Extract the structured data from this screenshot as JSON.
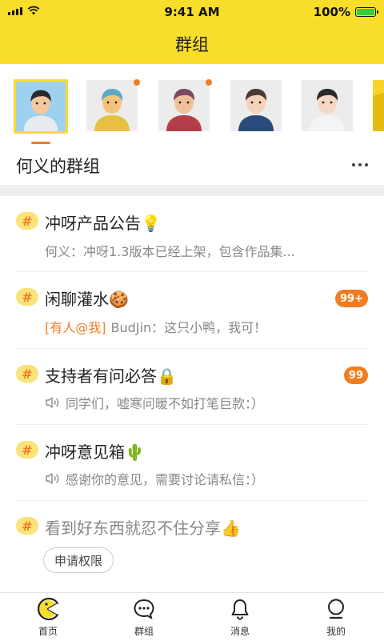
{
  "status_bar": {
    "time": "9:41 AM",
    "battery": "100%"
  },
  "nav": {
    "title": "群组"
  },
  "avatars": [
    {
      "name": "avatar-cartoon-man",
      "selected": true,
      "has_dot": false,
      "colors": {
        "bg": "#9ed0f0",
        "skin": "#f4c7a0",
        "hair": "#2a2a2a",
        "shirt": "#e7ecf0"
      }
    },
    {
      "name": "avatar-girl-pearl-earring",
      "selected": false,
      "has_dot": true,
      "colors": {
        "bg": "#ececec",
        "skin": "#f3c37a",
        "hair": "#5aa8c8",
        "shirt": "#e8bf40"
      }
    },
    {
      "name": "avatar-woman-purple-hair",
      "selected": false,
      "has_dot": true,
      "colors": {
        "bg": "#ececec",
        "skin": "#f0c09a",
        "hair": "#7a4a66",
        "shirt": "#b53d4a"
      }
    },
    {
      "name": "avatar-man-red-tie",
      "selected": false,
      "has_dot": false,
      "colors": {
        "bg": "#ececec",
        "skin": "#f4d2b8",
        "hair": "#4a3a36",
        "shirt": "#2a4a7c"
      }
    },
    {
      "name": "avatar-woman-sunglasses",
      "selected": false,
      "has_dot": false,
      "colors": {
        "bg": "#ececec",
        "skin": "#f4d7c4",
        "hair": "#2a2a2a",
        "shirt": "#f4f4f4"
      }
    },
    {
      "name": "avatar-partial-yellow",
      "selected": false,
      "has_dot": false,
      "colors": {
        "bg": "#f8d32a",
        "skin": "#f8d32a",
        "hair": "#e6bb10",
        "shirt": "#f8d32a"
      }
    }
  ],
  "group_header": {
    "title": "何义的群组"
  },
  "groups": [
    {
      "title": "冲呀产品公告💡",
      "subtitle": "何义：冲呀1.3版本已经上架，包含作品集...",
      "mention": "",
      "speaker_icon": false,
      "badge": "",
      "muted": false
    },
    {
      "title": "闲聊灌水🍪",
      "subtitle": "BudJin：这只小鸭，我可！",
      "mention": "[有人@我]",
      "speaker_icon": false,
      "badge": "99+",
      "muted": false
    },
    {
      "title": "支持者有问必答🔒",
      "subtitle": "同学们，嘘寒问暖不如打笔巨款：）",
      "mention": "",
      "speaker_icon": true,
      "badge": "99",
      "muted": false
    },
    {
      "title": "冲呀意见箱🌵",
      "subtitle": "感谢你的意见，需要讨论请私信：）",
      "mention": "",
      "speaker_icon": true,
      "badge": "",
      "muted": false
    },
    {
      "title": "看到好东西就忍不住分享👍",
      "subtitle": "",
      "mention": "",
      "speaker_icon": false,
      "badge": "",
      "muted": true,
      "action": "申请权限"
    }
  ],
  "tabs": [
    {
      "label": "首页",
      "icon": "home-pacman-icon",
      "active": true
    },
    {
      "label": "群组",
      "icon": "chat-bubble-icon",
      "active": false
    },
    {
      "label": "消息",
      "icon": "bell-icon",
      "active": false
    },
    {
      "label": "我的",
      "icon": "profile-icon",
      "active": false
    }
  ],
  "colors": {
    "accent": "#f8dd2a",
    "orange": "#f07d22",
    "tag_bg": "#fbe37a"
  }
}
